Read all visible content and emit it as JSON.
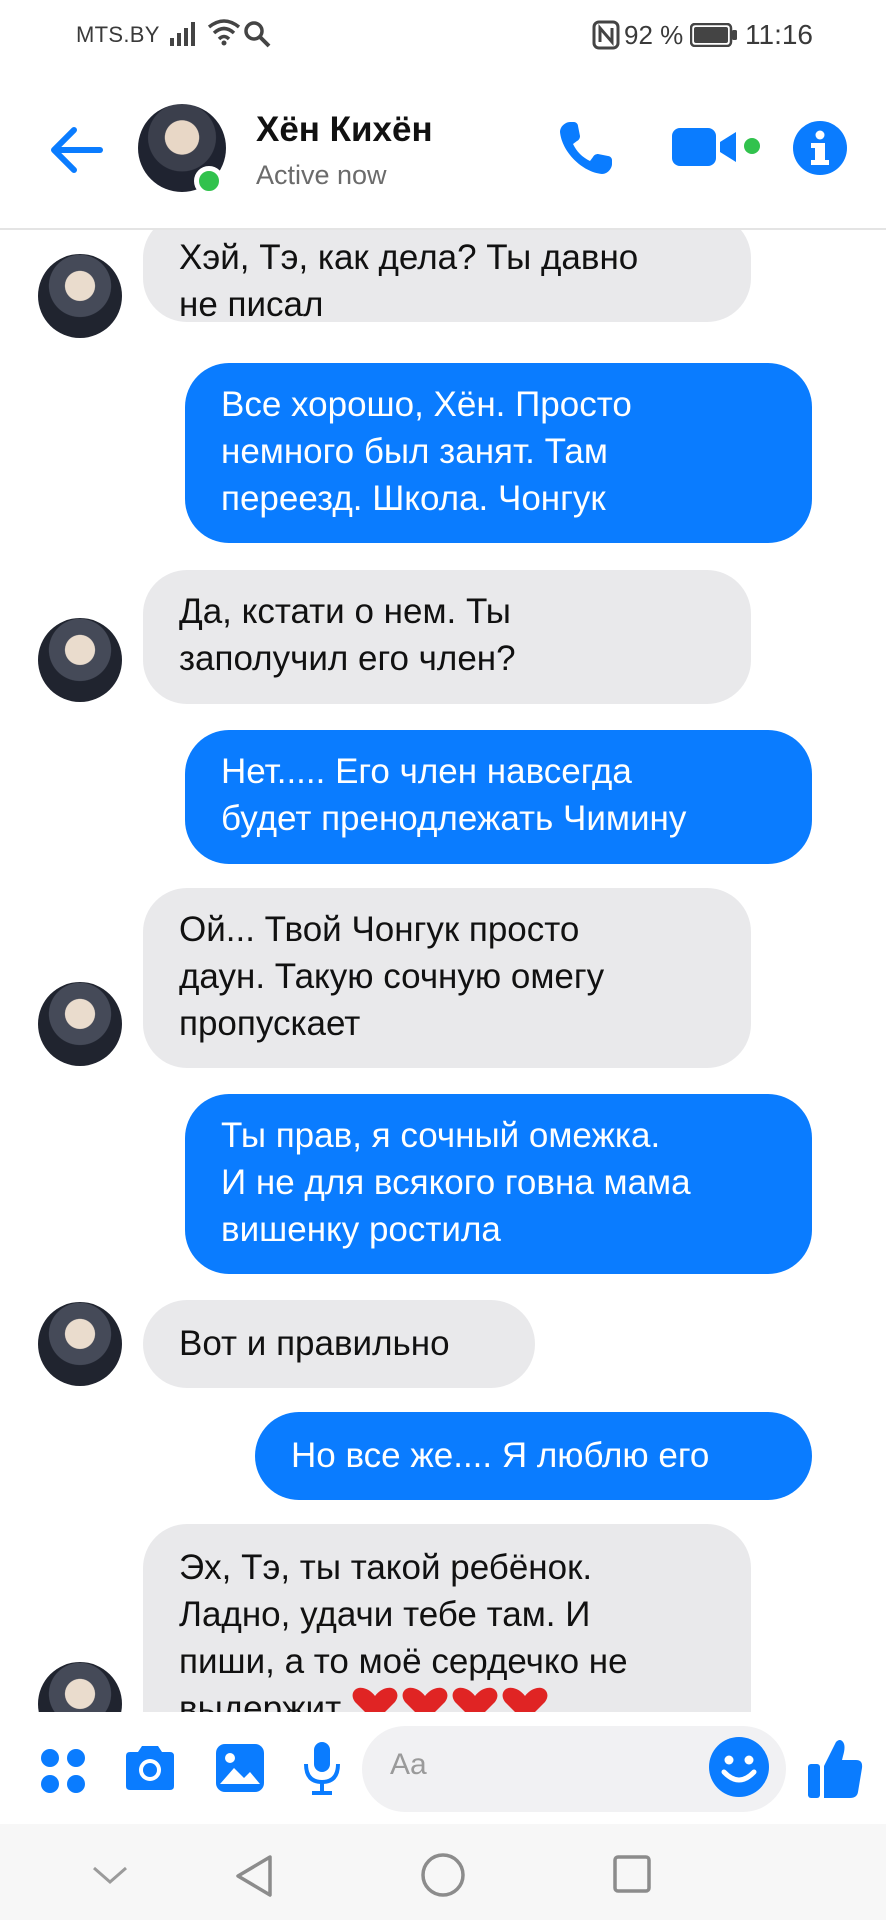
{
  "status_bar": {
    "carrier": "MTS.BY",
    "battery_percent": "92 %",
    "time": "11:16",
    "icons": [
      "signal-icon",
      "wifi-icon",
      "search-icon",
      "nfc-icon",
      "battery-icon"
    ]
  },
  "header": {
    "contact_name": "Хён Кихён",
    "status": "Active now",
    "icons": [
      "back-arrow-icon",
      "phone-icon",
      "video-camera-icon",
      "info-icon"
    ]
  },
  "messages": [
    {
      "direction": "incoming",
      "lines": [
        "Хэй, Тэ, как дела? Ты давно",
        "не писал"
      ]
    },
    {
      "direction": "outgoing",
      "lines": [
        "Все хорошо, Хён. Просто",
        "немного был занят. Там",
        "переезд. Школа. Чонгук"
      ]
    },
    {
      "direction": "incoming",
      "lines": [
        "Да, кстати о нем. Ты",
        "заполучил его член?"
      ]
    },
    {
      "direction": "outgoing",
      "lines": [
        "Нет..... Его член навсегда",
        "будет пренодлежать Чимину"
      ]
    },
    {
      "direction": "incoming",
      "lines": [
        "Ой... Твой Чонгук просто",
        "даун. Такую сочную омегу",
        "пропускает"
      ]
    },
    {
      "direction": "outgoing",
      "lines": [
        "Ты прав, я сочный омежка.",
        "И не для всякого говна мама",
        "вишенку ростила"
      ]
    },
    {
      "direction": "incoming",
      "lines": [
        "Вот и правильно"
      ]
    },
    {
      "direction": "outgoing",
      "lines": [
        "Но все же.... Я люблю его"
      ]
    },
    {
      "direction": "incoming",
      "lines": [
        "Эх, Тэ, ты такой ребёнок.",
        "Ладно, удачи тебе там. И",
        "пиши, а то моё сердечко не",
        "выдержит"
      ],
      "trailing_icons": "heart-icon x4"
    }
  ],
  "composer": {
    "placeholder": "Aa",
    "icons": [
      "apps-icon",
      "camera-icon",
      "gallery-icon",
      "microphone-icon",
      "emoji-icon",
      "thumbs-up-icon"
    ]
  },
  "nav_bar": {
    "icons": [
      "collapse-chevron-icon",
      "back-triangle-icon",
      "home-circle-icon",
      "recents-square-icon"
    ]
  },
  "colors": {
    "accent": "#0a7cff",
    "incoming_bubble": "#e9e9eb",
    "presence": "#31c24d"
  }
}
